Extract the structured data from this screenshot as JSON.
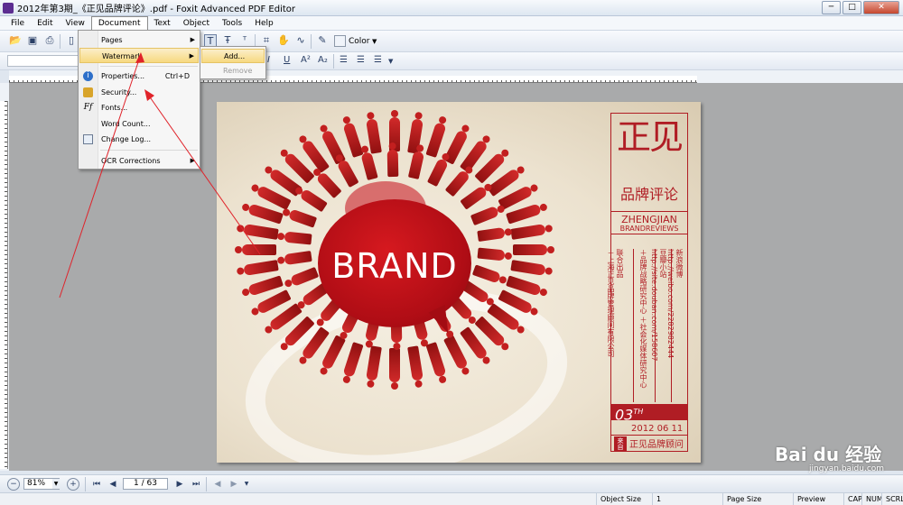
{
  "window": {
    "title": "2012年第3期_《正见品牌评论》.pdf - Foxit Advanced PDF Editor",
    "controls": {
      "minimize": "─",
      "maximize": "□",
      "close": "✕"
    }
  },
  "menubar": [
    "File",
    "Edit",
    "View",
    "Document",
    "Text",
    "Object",
    "Tools",
    "Help"
  ],
  "toolbar": {
    "color_label": "Color"
  },
  "document_menu": {
    "items": [
      {
        "label": "Pages",
        "shortcut": "",
        "submenu": true,
        "icon": ""
      },
      {
        "label": "Watermark",
        "shortcut": "",
        "submenu": true,
        "icon": ""
      },
      {
        "label": "Properties...",
        "shortcut": "Ctrl+D",
        "submenu": false,
        "icon": "info-icon"
      },
      {
        "label": "Security...",
        "shortcut": "",
        "submenu": false,
        "icon": "lock-icon"
      },
      {
        "label": "Fonts...",
        "shortcut": "",
        "submenu": false,
        "icon": "font-icon"
      },
      {
        "label": "Word Count...",
        "shortcut": "",
        "submenu": false,
        "icon": ""
      },
      {
        "label": "Change Log...",
        "shortcut": "",
        "submenu": false,
        "icon": "log-icon"
      },
      {
        "label": "OCR Corrections",
        "shortcut": "",
        "submenu": true,
        "icon": ""
      }
    ],
    "highlighted": "Watermark"
  },
  "watermark_submenu": {
    "items": [
      {
        "label": "Add...",
        "enabled": true
      },
      {
        "label": "Remove",
        "enabled": false
      }
    ]
  },
  "cover": {
    "brand_word": "BRAND",
    "masthead_big": "正见",
    "masthead_sub": "品牌评论",
    "masthead_en1": "ZHENGJIAN",
    "masthead_en2": "BRANDREVIEWS",
    "col1_title": "联合出品",
    "col1_text": "＋上海正见品牌管理顾问有限公司",
    "col2_text": "＋品牌战略研究中心 ＋社会化媒体研究中心",
    "col3_title": "豆瓣小站",
    "col3_text": "http://site.douban.com/158607",
    "col4_title": "新浪微博",
    "col4_text": "http://weibo.com/2282982444",
    "issue_number": "03",
    "issue_suffix": "TH",
    "issue_date": "2012 06 11",
    "from_label": "来自",
    "bottom_brand": "正见品牌顾问"
  },
  "navigation": {
    "zoom": "81%",
    "page": "1 / 63"
  },
  "statusbar": {
    "object_size_label": "Object Size",
    "object_size_value": "1",
    "page_size_label": "Page Size",
    "preview_label": "Preview",
    "cap": "CAP",
    "num": "NUM",
    "scrl": "SCRL"
  },
  "watermark_logo": {
    "brand": "Bai du 经验",
    "url": "jingyan.baidu.com"
  },
  "colors": {
    "accent_red": "#b01d24",
    "menu_highlight": "#f7d980",
    "annotation_arrow": "#e0232a"
  }
}
